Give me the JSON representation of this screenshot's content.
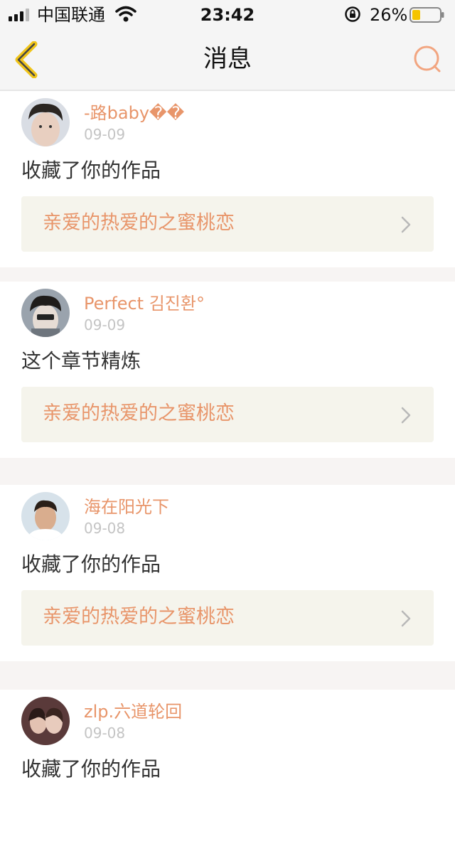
{
  "status_bar": {
    "carrier": "中国联通",
    "time": "23:42",
    "battery": "26%"
  },
  "header": {
    "title": "消息"
  },
  "colors": {
    "accent": "#e8956a",
    "back_icon": "#f0c419",
    "card_bg": "#f5f4ec"
  },
  "icons": {
    "back": "chevron-left-icon",
    "search": "search-icon",
    "chevron": "chevron-right-icon"
  },
  "messages": [
    {
      "user": "-路baby��",
      "date": "09-09",
      "text": "收藏了你的作品",
      "work": "亲爱的热爱的之蜜桃恋"
    },
    {
      "user": "Perfect 김진환°",
      "date": "09-09",
      "text": "这个章节精炼",
      "work": "亲爱的热爱的之蜜桃恋"
    },
    {
      "user": "海在阳光下",
      "date": "09-08",
      "text": "收藏了你的作品",
      "work": "亲爱的热爱的之蜜桃恋"
    },
    {
      "user": "zlp.六道轮回",
      "date": "09-08",
      "text": "收藏了你的作品"
    }
  ]
}
